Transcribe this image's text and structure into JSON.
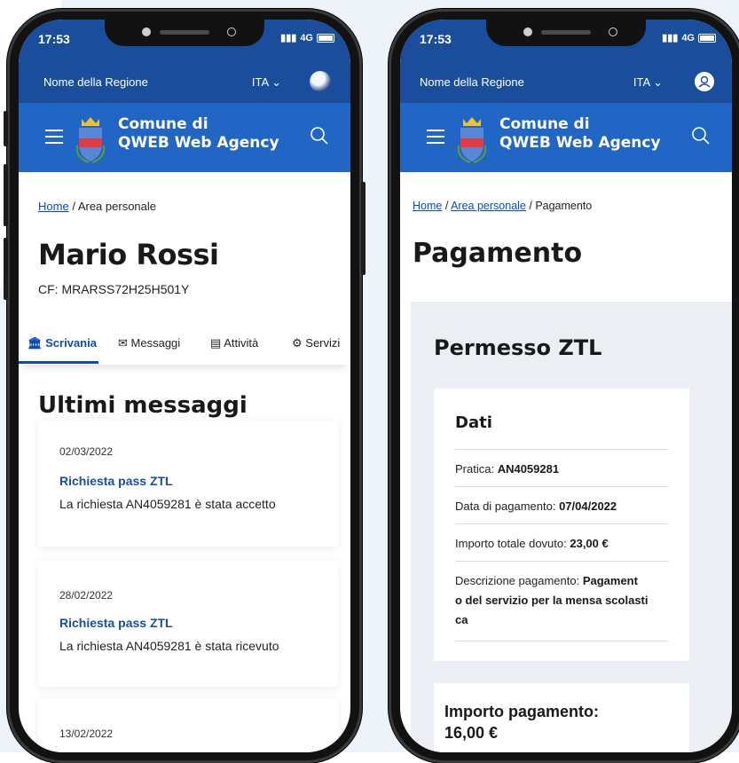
{
  "colors": {
    "header_dark": "#1a4d9c",
    "header": "#2165c5",
    "link": "#0b4bb5",
    "bg_shape": "#eef2f9"
  },
  "left_phone": {
    "status": {
      "time": "17:53",
      "signal": "4G"
    },
    "topbar": {
      "region": "Nome della Regione",
      "lang": "ITA"
    },
    "header": {
      "title_line1": "Comune di",
      "title_line2": "QWEB Web Agency"
    },
    "breadcrumb": {
      "home": "Home",
      "current": "Area personale"
    },
    "page_title": "Mario Rossi",
    "cf": "CF: MRARSS72H25H501Y",
    "tabs": [
      {
        "icon": "bank-icon",
        "label": "Scrivania"
      },
      {
        "icon": "mail-icon",
        "label": "Messaggi"
      },
      {
        "icon": "calendar-icon",
        "label": "Attività"
      },
      {
        "icon": "gear-icon",
        "label": "Servizi"
      }
    ],
    "section_title": "Ultimi messaggi",
    "messages": [
      {
        "date": "02/03/2022",
        "subject": "Richiesta pass ZTL",
        "text": "La richiesta AN4059281 è stata accetto"
      },
      {
        "date": "28/02/2022",
        "subject": "Richiesta pass ZTL",
        "text": "La richiesta AN4059281 è stata ricevuto"
      },
      {
        "date": "13/02/2022",
        "subject": "",
        "text": ""
      }
    ]
  },
  "right_phone": {
    "status": {
      "time": "17:53",
      "signal": "4G"
    },
    "topbar": {
      "region": "Nome della Regione",
      "lang": "ITA"
    },
    "header": {
      "title_line1": "Comune di",
      "title_line2": "QWEB Web Agency"
    },
    "breadcrumb": {
      "home": "Home",
      "area": "Area personale",
      "current": "Pagamento"
    },
    "page_title": "Pagamento",
    "panel_title": "Permesso ZTL",
    "dati": {
      "title": "Dati",
      "pratica_label": "Pratica: ",
      "pratica_value": "AN4059281",
      "data_label": "Data di pagamento: ",
      "data_value": "07/04/2022",
      "importo_label": "Importo totale dovuto: ",
      "importo_value": "23,00 €",
      "descr_label": "Descrizione pagamento: ",
      "descr_value1": "Pagament",
      "descr_value2": "o del servizio per la mensa scolasti",
      "descr_value3": "ca"
    },
    "importo_pagamento_line1": "Importo pagamento:",
    "importo_pagamento_line2": "16,00 €"
  }
}
